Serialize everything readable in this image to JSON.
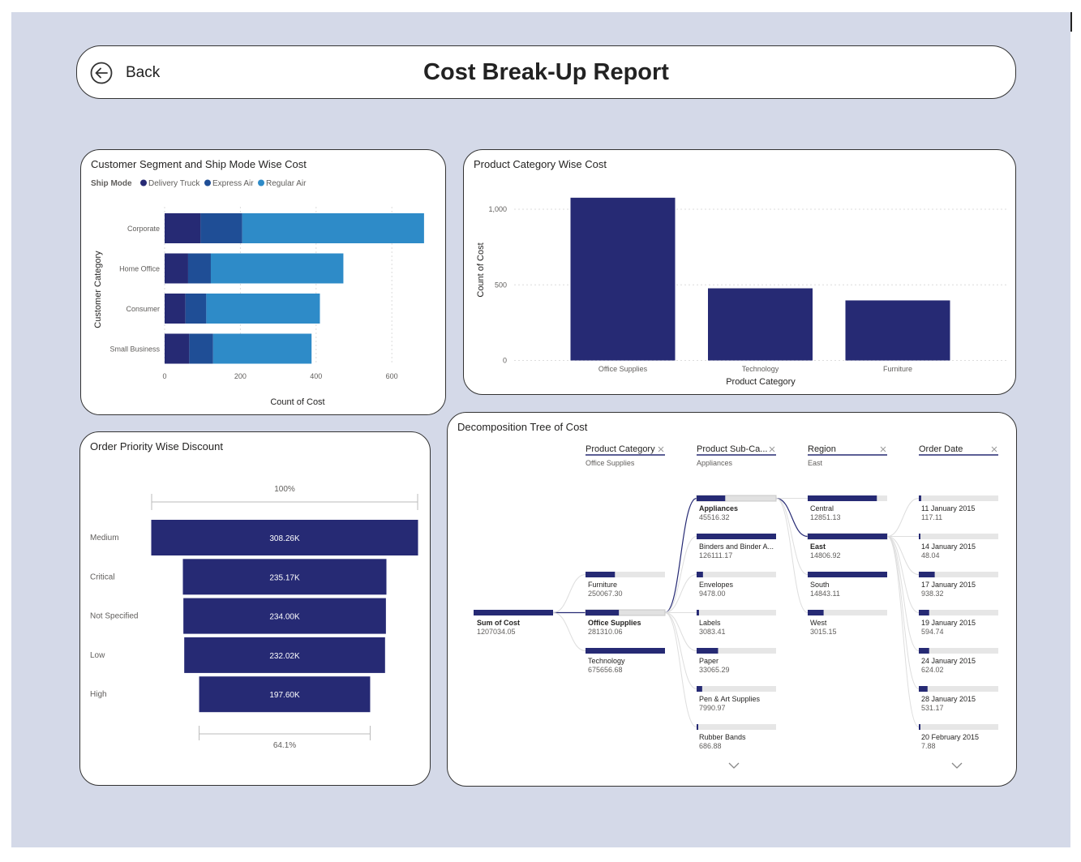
{
  "header": {
    "back_label": "Back",
    "title": "Cost Break-Up Report"
  },
  "colors": {
    "delivery_truck": "#262a74",
    "express_air": "#1f4e96",
    "regular_air": "#2e8bc8",
    "bar": "#262a74",
    "track": "#e6e6e6",
    "bg": "#d4d9e8"
  },
  "card_segment": {
    "title": "Customer Segment and Ship Mode Wise Cost",
    "legend_title": "Ship Mode",
    "legend": [
      "Delivery Truck",
      "Express Air",
      "Regular Air"
    ],
    "ylabel": "Customer Category",
    "xlabel": "Count of Cost"
  },
  "card_product": {
    "title": "Product Category Wise Cost",
    "ylabel": "Count of Cost",
    "xlabel": "Product Category"
  },
  "card_priority": {
    "title": "Order Priority Wise Discount",
    "top_pct": "100%",
    "bottom_pct": "64.1%"
  },
  "card_decomp": {
    "title": "Decomposition Tree of Cost",
    "columns": [
      {
        "header": "Product Category",
        "filter": "Office Supplies"
      },
      {
        "header": "Product Sub-Ca...",
        "filter": "Appliances"
      },
      {
        "header": "Region",
        "filter": "East"
      },
      {
        "header": "Order Date",
        "filter": ""
      }
    ],
    "root": {
      "label": "Sum of Cost",
      "value": "1207034.05"
    },
    "categories": [
      {
        "label": "Furniture",
        "value": "250067.30",
        "fraction": 0.37,
        "selected": false
      },
      {
        "label": "Office Supplies",
        "value": "281310.06",
        "fraction": 0.42,
        "selected": true
      },
      {
        "label": "Technology",
        "value": "675656.68",
        "fraction": 1.0,
        "selected": false
      }
    ],
    "subcategories": [
      {
        "label": "Appliances",
        "value": "45516.32",
        "fraction": 0.36,
        "selected": true
      },
      {
        "label": "Binders and Binder A...",
        "value": "126111.17",
        "fraction": 1.0,
        "selected": false
      },
      {
        "label": "Envelopes",
        "value": "9478.00",
        "fraction": 0.08,
        "selected": false
      },
      {
        "label": "Labels",
        "value": "3083.41",
        "fraction": 0.03,
        "selected": false
      },
      {
        "label": "Paper",
        "value": "33065.29",
        "fraction": 0.27,
        "selected": false
      },
      {
        "label": "Pen & Art Supplies",
        "value": "7990.97",
        "fraction": 0.07,
        "selected": false
      },
      {
        "label": "Rubber Bands",
        "value": "686.88",
        "fraction": 0.01,
        "selected": false
      }
    ],
    "regions": [
      {
        "label": "Central",
        "value": "12851.13",
        "fraction": 0.87,
        "selected": false
      },
      {
        "label": "East",
        "value": "14806.92",
        "fraction": 1.0,
        "selected": true
      },
      {
        "label": "South",
        "value": "14843.11",
        "fraction": 1.0,
        "selected": false
      },
      {
        "label": "West",
        "value": "3015.15",
        "fraction": 0.2,
        "selected": false
      }
    ],
    "dates": [
      {
        "label": "11 January 2015",
        "value": "117.11",
        "fraction": 0.03
      },
      {
        "label": "14 January 2015",
        "value": "48.04",
        "fraction": 0.01
      },
      {
        "label": "17 January 2015",
        "value": "938.32",
        "fraction": 0.2
      },
      {
        "label": "19 January 2015",
        "value": "594.74",
        "fraction": 0.13
      },
      {
        "label": "24 January 2015",
        "value": "624.02",
        "fraction": 0.13
      },
      {
        "label": "28 January 2015",
        "value": "531.17",
        "fraction": 0.11
      },
      {
        "label": "20 February 2015",
        "value": "7.88",
        "fraction": 0.01
      }
    ]
  },
  "chart_data": [
    {
      "type": "bar",
      "orientation": "horizontal",
      "stacked": true,
      "title": "Customer Segment and Ship Mode Wise Cost",
      "categories": [
        "Corporate",
        "Home Office",
        "Consumer",
        "Small Business"
      ],
      "series": [
        {
          "name": "Delivery Truck",
          "values": [
            95,
            62,
            55,
            65
          ]
        },
        {
          "name": "Express Air",
          "values": [
            110,
            60,
            55,
            63
          ]
        },
        {
          "name": "Regular Air",
          "values": [
            480,
            350,
            300,
            260
          ]
        }
      ],
      "xlabel": "Count of Cost",
      "ylabel": "Customer Category",
      "xticks": [
        0,
        200,
        400,
        600
      ],
      "xlim": [
        0,
        700
      ],
      "grid": true,
      "legend_position": "top-left"
    },
    {
      "type": "bar",
      "title": "Product Category Wise Cost",
      "categories": [
        "Office Supplies",
        "Technology",
        "Furniture"
      ],
      "values": [
        1076,
        477,
        397
      ],
      "xlabel": "Product Category",
      "ylabel": "Count of Cost",
      "yticks": [
        0,
        500,
        1000
      ],
      "ytick_labels": [
        "0",
        "500",
        "1,000"
      ],
      "ylim": [
        0,
        1100
      ],
      "grid": true
    },
    {
      "type": "bar",
      "subtype": "funnel",
      "title": "Order Priority Wise Discount",
      "categories": [
        "Medium",
        "Critical",
        "Not Specified",
        "Low",
        "High"
      ],
      "values": [
        308.26,
        235.17,
        234.0,
        232.02,
        197.6
      ],
      "value_labels": [
        "308.26K",
        "235.17K",
        "234.00K",
        "232.02K",
        "197.60K"
      ],
      "unit": "K"
    }
  ]
}
